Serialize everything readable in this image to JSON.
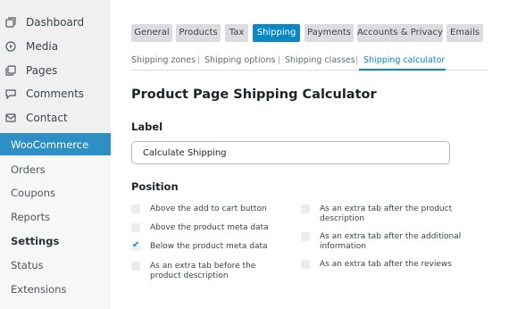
{
  "sidebar": {
    "top_items": [
      {
        "label": "Dashboard",
        "icon": "dashboard-icon"
      },
      {
        "label": "Media",
        "icon": "media-icon"
      },
      {
        "label": "Pages",
        "icon": "pages-icon"
      },
      {
        "label": "Comments",
        "icon": "comments-icon"
      },
      {
        "label": "Contact",
        "icon": "contact-icon"
      }
    ],
    "section": "WooCommerce",
    "sub_items": [
      {
        "label": "Orders"
      },
      {
        "label": "Coupons"
      },
      {
        "label": "Reports"
      },
      {
        "label": "Settings",
        "active": true
      },
      {
        "label": "Status"
      },
      {
        "label": "Extensions"
      }
    ]
  },
  "tabs": [
    "General",
    "Products",
    "Tax",
    "Shipping",
    "Payments",
    "Accounts & Privacy",
    "Emails"
  ],
  "active_tab": "Shipping",
  "subnav": [
    "Shipping zones",
    "Shipping options",
    "Shipping classes",
    "Shipping calculator"
  ],
  "subnav_separator": "|",
  "active_subnav": "Shipping calculator",
  "page_title": "Product Page Shipping Calculator",
  "label_section": {
    "heading": "Label",
    "value": "Calculate Shipping"
  },
  "position_section": {
    "heading": "Position",
    "options": [
      {
        "label": "Above the add to cart button",
        "checked": false
      },
      {
        "label": "Above the product meta data",
        "checked": false
      },
      {
        "label": "Below the product meta data",
        "checked": true
      },
      {
        "label": "As an extra tab before the product description",
        "checked": false
      },
      {
        "label": "As an extra tab after the product description",
        "checked": false
      },
      {
        "label": "As an extra tab after the additional information",
        "checked": false
      },
      {
        "label": "As an extra tab after the reviews",
        "checked": false
      }
    ]
  },
  "colors": {
    "accent": "#0a88c4",
    "woo_header": "#2d8fc3",
    "sidebar_bg": "#f0f0f1"
  }
}
